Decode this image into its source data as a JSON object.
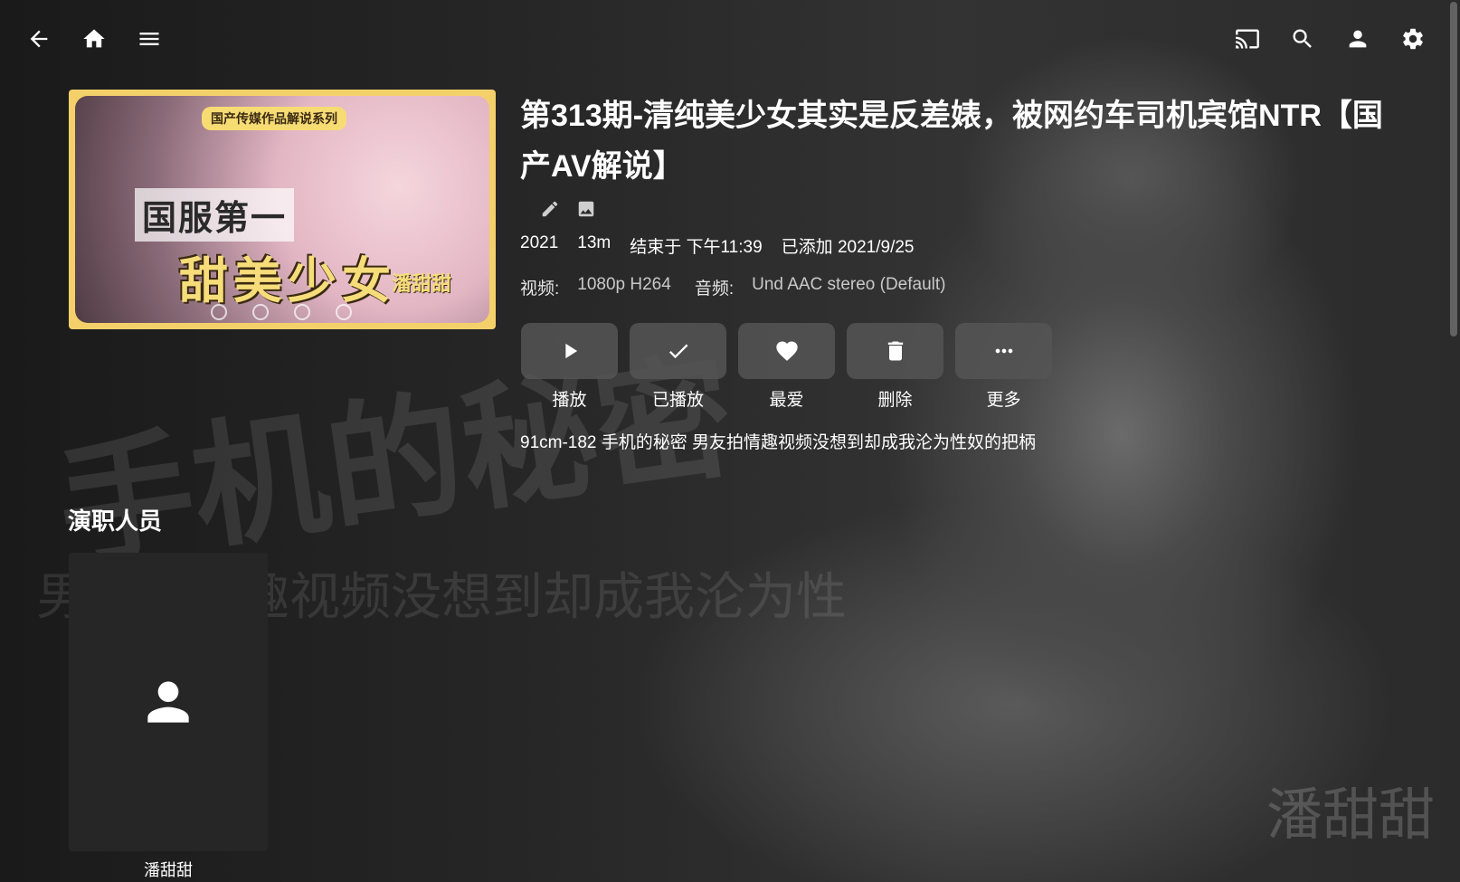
{
  "colors": {
    "poster_border": "#f4d06b",
    "action_bg": "#555555",
    "cast_card_bg": "#262626"
  },
  "topbar": {
    "left": [
      {
        "name": "back",
        "icon": "arrow-back-icon"
      },
      {
        "name": "home",
        "icon": "home-icon"
      },
      {
        "name": "menu",
        "icon": "menu-icon"
      }
    ],
    "right": [
      {
        "name": "cast",
        "icon": "cast-icon"
      },
      {
        "name": "search",
        "icon": "search-icon"
      },
      {
        "name": "user",
        "icon": "user-icon"
      },
      {
        "name": "settings",
        "icon": "gear-icon"
      }
    ]
  },
  "poster": {
    "pill": "国产传媒作品解说系列",
    "line1": "国服第一",
    "line2": "甜美少女",
    "name": "潘甜甜"
  },
  "background_text": {
    "big": "手机的秘密",
    "mid": "男友拍情趣视频没想到却成我沦为性",
    "signature": "潘甜甜"
  },
  "item": {
    "title": "第313期-清纯美少女其实是反差婊，被网约车司机宾馆NTR【国产AV解说】",
    "year": "2021",
    "runtime": "13m",
    "ends_at": "结束于 下午11:39",
    "added": "已添加 2021/9/25",
    "video_label": "视频:",
    "video_value": "1080p H264",
    "audio_label": "音频:",
    "audio_value": "Und AAC stereo (Default)",
    "overview": "91cm-182 手机的秘密 男友拍情趣视频没想到却成我沦为性奴的把柄"
  },
  "actions": [
    {
      "label": "播放",
      "icon": "play-icon"
    },
    {
      "label": "已播放",
      "icon": "check-icon"
    },
    {
      "label": "最爱",
      "icon": "heart-icon"
    },
    {
      "label": "删除",
      "icon": "trash-icon"
    },
    {
      "label": "更多",
      "icon": "more-icon"
    }
  ],
  "cast": {
    "section_title": "演职人员",
    "people": [
      {
        "name": "潘甜甜",
        "icon": "person-icon"
      }
    ]
  }
}
